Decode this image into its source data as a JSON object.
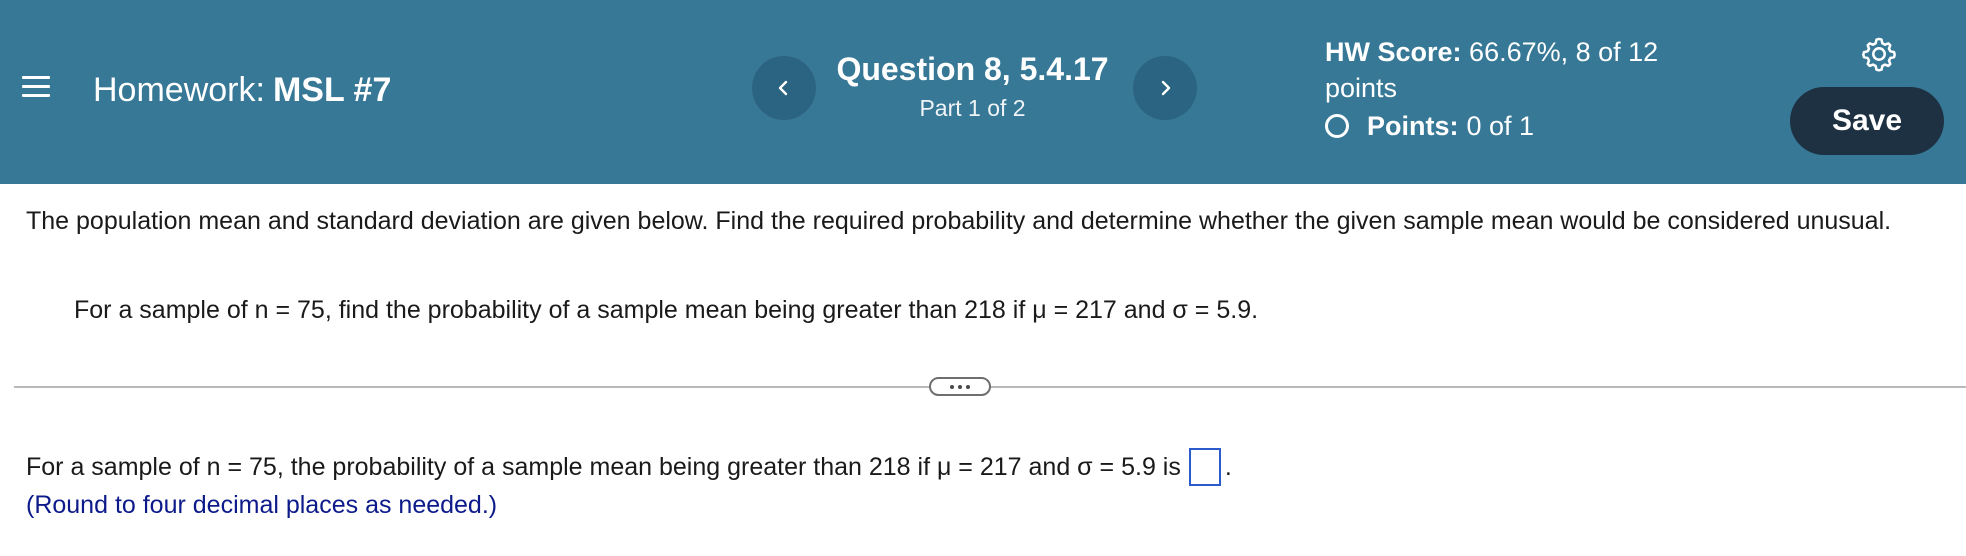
{
  "header": {
    "homework_label": "Homework:",
    "homework_name": "MSL #7",
    "question_title": "Question 8, 5.4.17",
    "question_part": "Part 1 of 2",
    "hw_score_label": "HW Score:",
    "hw_score_value": "66.67%, 8 of 12 points",
    "points_label": "Points:",
    "points_value": "0 of 1",
    "save_label": "Save",
    "icons": {
      "menu": "hamburger-menu-icon",
      "prev": "chevron-left-icon",
      "next": "chevron-right-icon",
      "settings": "gear-icon",
      "points": "circle-outline-icon"
    }
  },
  "main": {
    "instructions": "The population mean and standard deviation are given below. Find the required probability and determine whether the given sample mean would be considered unusual.",
    "question": "For a sample of n = 75, find the probability of a sample mean being greater than 218 if μ = 217 and σ = 5.9.",
    "answer_prompt": "For a sample of n = 75, the probability of a sample mean being greater than 218 if μ = 217 and σ = 5.9 is",
    "answer_value": "",
    "answer_suffix": ".",
    "round_note": "(Round to four decimal places as needed.)"
  },
  "colors": {
    "header_bg": "#377896",
    "nav_button_bg": "#2b6482",
    "save_button_bg": "#1d3142",
    "answer_box_border": "#2c5ccc",
    "note_text": "#0c1a8a"
  }
}
